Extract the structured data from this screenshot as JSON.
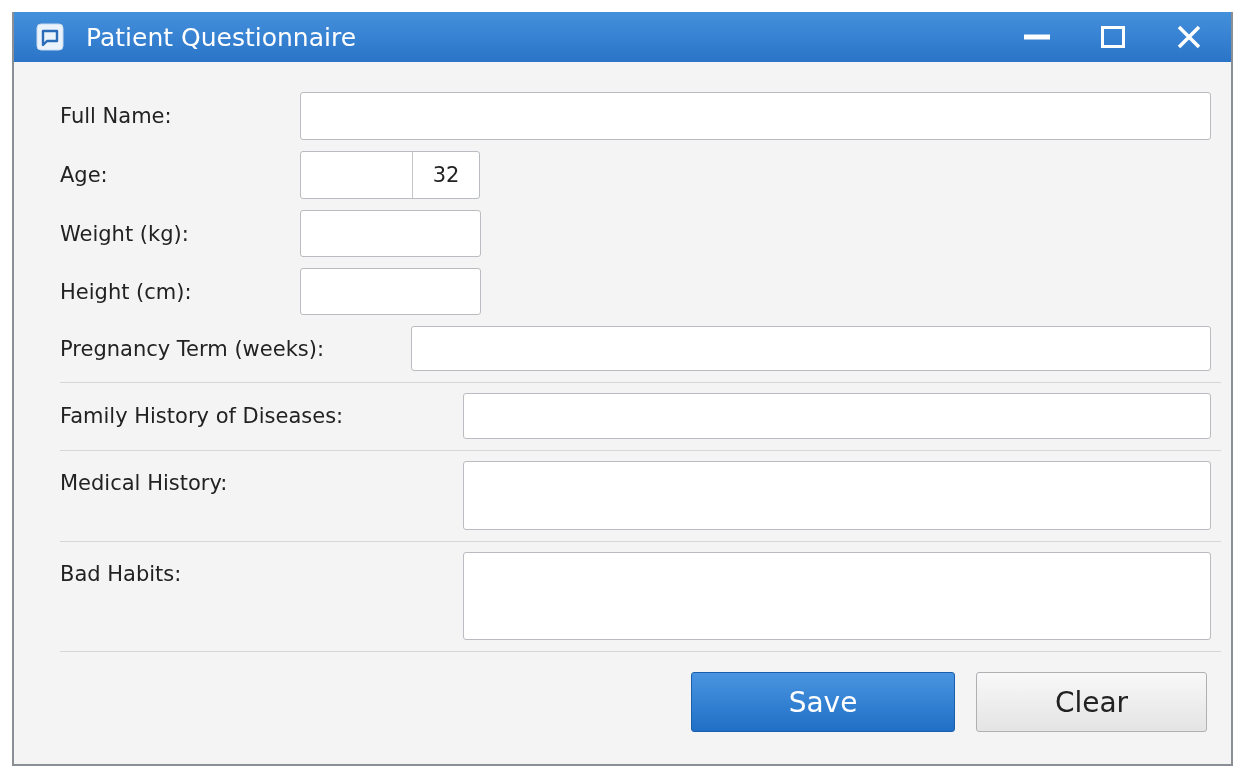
{
  "window": {
    "title": "Patient Questionnaire"
  },
  "sections": [
    {
      "fields": [
        {
          "kind": "wide",
          "label": "Full Name:"
        },
        {
          "kind": "number",
          "label": "Age:",
          "value": "32"
        },
        {
          "kind": "short",
          "label": "Weight (kg):"
        },
        {
          "kind": "short",
          "label": "Height (cm):"
        },
        {
          "kind": "inline",
          "label": "Pregnancy Term (weeks):"
        }
      ]
    },
    {
      "fields": [
        {
          "kind": "line",
          "label": "Family History of Diseases:"
        }
      ]
    },
    {
      "fields": [
        {
          "kind": "area",
          "label": "Medical History:"
        }
      ]
    },
    {
      "fields": [
        {
          "kind": "tallarea",
          "label": "Bad Habits:"
        }
      ]
    }
  ],
  "buttons": [
    {
      "label": "Save",
      "kind": "primary"
    },
    {
      "label": "Clear",
      "kind": "secondary"
    }
  ]
}
